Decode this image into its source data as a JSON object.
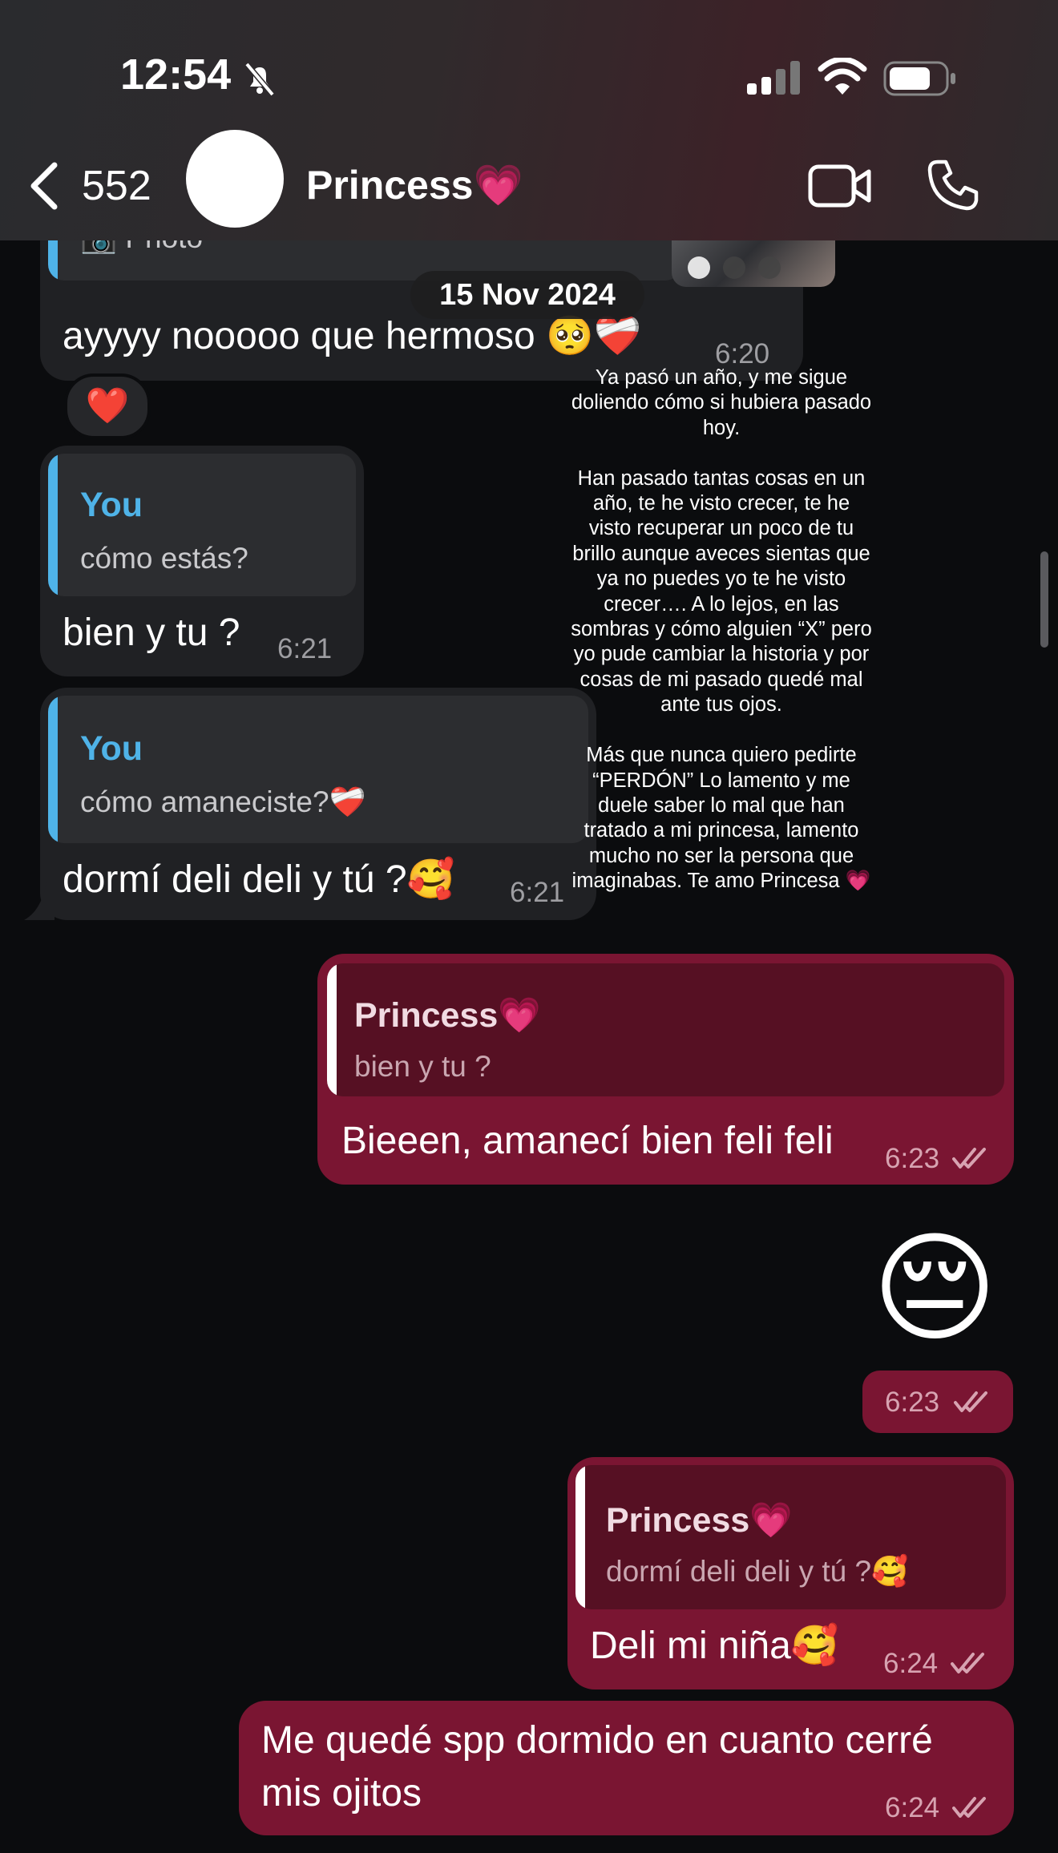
{
  "status_bar": {
    "time": "12:54"
  },
  "header": {
    "back_count": "552",
    "contact_name": "Princess💗"
  },
  "date_separator": "15 Nov 2024",
  "overlay_text": "Ya pasó un año, y me sigue doliendo cómo si hubiera pasado hoy.\n\nHan pasado tantas cosas en un año, te he visto crecer, te he visto recuperar un poco de tu brillo aunque aveces sientas que ya no puedes yo te he visto crecer…. A lo lejos, en las sombras y cómo alguien “X” pero yo pude cambiar la historia y por cosas de mi pasado quedé mal ante tus ojos.\n\nMás que nunca quiero pedirte “PERDÓN” Lo lamento y me duele saber lo mal que han tratado a mi princesa, lamento mucho no ser la persona que imaginabas. Te amo Princesa 💗",
  "messages": [
    {
      "direction": "incoming",
      "reply_to": {
        "text": "📷 Photo"
      },
      "text": "ayyyy nooooo que hermoso 🥺❤️‍🩹",
      "time": "6:20",
      "reaction": "❤️"
    },
    {
      "direction": "incoming",
      "reply_to": {
        "author": "You",
        "text": "cómo estás?"
      },
      "text": "bien y tu ?",
      "time": "6:21"
    },
    {
      "direction": "incoming",
      "reply_to": {
        "author": "You",
        "text": "cómo amaneciste?❤️‍🩹"
      },
      "text": "dormí deli deli y tú ?🥰",
      "time": "6:21"
    },
    {
      "direction": "outgoing",
      "reply_to": {
        "author": "Princess💗",
        "text": "bien y tu ?"
      },
      "text": "Bieeen, amanecí bien feli feli",
      "time": "6:23"
    },
    {
      "direction": "outgoing",
      "emoji": "😔",
      "time": "6:23"
    },
    {
      "direction": "outgoing",
      "reply_to": {
        "author": "Princess💗",
        "text": "dormí deli deli y tú ?🥰"
      },
      "text": "Deli mi niña🥰",
      "time": "6:24"
    },
    {
      "direction": "outgoing",
      "text_line1": "Me quedé spp dormido en cuanto cerré",
      "text_line2": "mis ojitos",
      "time": "6:24"
    }
  ]
}
